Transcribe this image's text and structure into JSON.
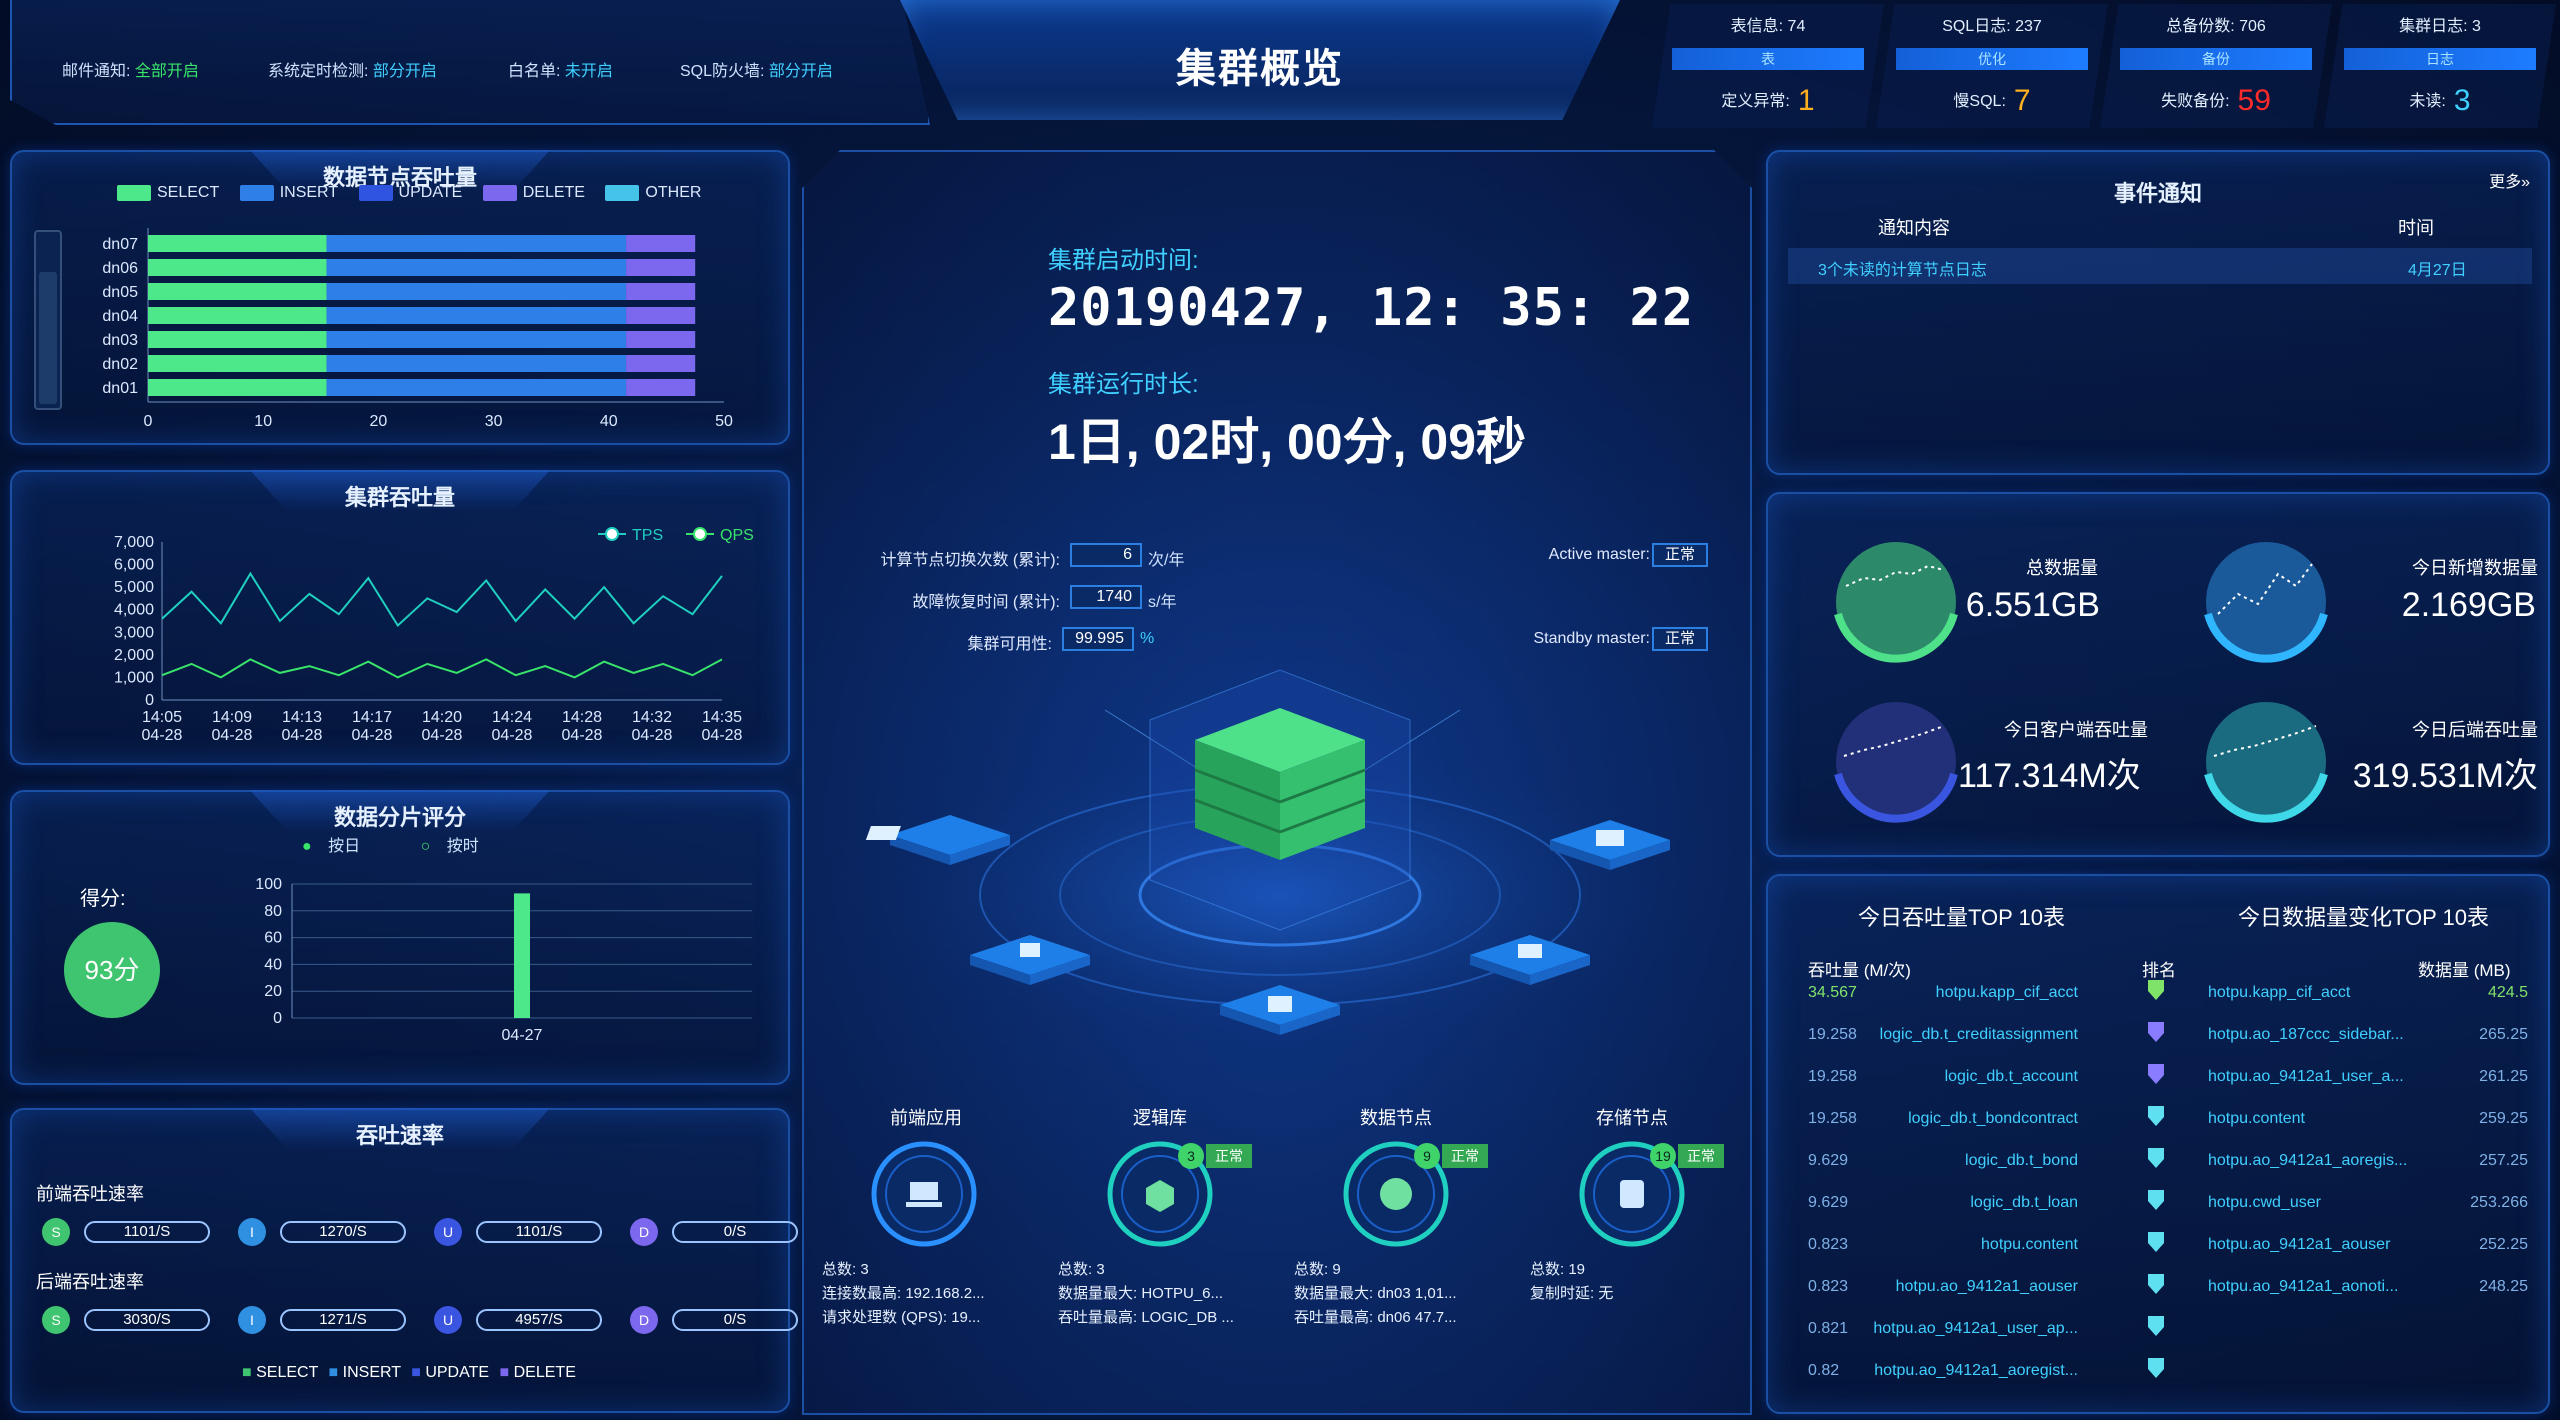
{
  "header": {
    "title": "集群概览",
    "left_items": [
      {
        "label": "邮件通知:",
        "value": "全部开启",
        "color": "#39e46a"
      },
      {
        "label": "系统定时检测:",
        "value": "部分开启",
        "color": "#3fd0ff"
      },
      {
        "label": "白名单:",
        "value": "未开启",
        "color": "#3fd0ff"
      },
      {
        "label": "SQL防火墙:",
        "value": "部分开启",
        "color": "#3fd0ff"
      }
    ],
    "stats": [
      {
        "top_label": "表信息:",
        "top_value": "74",
        "mid": "表",
        "bot_label": "定义异常:",
        "bot_value": "1",
        "bot_color": "#ffb020"
      },
      {
        "top_label": "SQL日志:",
        "top_value": "237",
        "mid": "优化",
        "bot_label": "慢SQL:",
        "bot_value": "7",
        "bot_color": "#ffb020"
      },
      {
        "top_label": "总备份数:",
        "top_value": "706",
        "mid": "备份",
        "bot_label": "失败备份:",
        "bot_value": "59",
        "bot_color": "#ff2a2a"
      },
      {
        "top_label": "集群日志:",
        "top_value": "3",
        "mid": "日志",
        "bot_label": "未读:",
        "bot_value": "3",
        "bot_color": "#3fd0ff"
      }
    ]
  },
  "throughput_nodes": {
    "title": "数据节点吞吐量",
    "legend": [
      {
        "name": "SELECT",
        "color": "#4de88a"
      },
      {
        "name": "INSERT",
        "color": "#2f7fe8"
      },
      {
        "name": "UPDATE",
        "color": "#2f55e0"
      },
      {
        "name": "DELETE",
        "color": "#7b68ee"
      },
      {
        "name": "OTHER",
        "color": "#45c3e8"
      }
    ]
  },
  "cluster_throughput": {
    "title": "集群吞吐量",
    "legend": [
      {
        "name": "TPS",
        "color": "#1fd0c0"
      },
      {
        "name": "QPS",
        "color": "#39e46a"
      }
    ]
  },
  "shard_score": {
    "title": "数据分片评分",
    "legend": [
      {
        "name": "按日",
        "color": "#39e46a"
      },
      {
        "name": "按时",
        "color": "#39e46a"
      }
    ],
    "score_label": "得分:",
    "score_value": "93分"
  },
  "rate": {
    "title": "吞吐速率",
    "front_label": "前端吞吐速率",
    "back_label": "后端吞吐速率",
    "badges": [
      "S",
      "I",
      "U",
      "D"
    ],
    "front_values": [
      "1101/S",
      "1270/S",
      "1101/S",
      "0/S"
    ],
    "back_values": [
      "3030/S",
      "1271/S",
      "4957/S",
      "0/S"
    ],
    "legend": [
      "SELECT",
      "INSERT",
      "UPDATE",
      "DELETE"
    ]
  },
  "center": {
    "start_label": "集群启动时间:",
    "start_value": "20190427, 12: 35: 22",
    "uptime_label": "集群运行时长:",
    "uptime_value": "1日, 02时, 00分, 09秒",
    "switch_label": "计算节点切换次数 (累计):",
    "switch_value": "6",
    "switch_unit": "次/年",
    "recover_label": "故障恢复时间 (累计):",
    "recover_value": "1740",
    "recover_unit": "s/年",
    "avail_label": "集群可用性:",
    "avail_value": "99.995",
    "avail_unit": "%",
    "active_label": "Active master:",
    "active_value": "正常",
    "standby_label": "Standby master:",
    "standby_value": "正常",
    "nodes": [
      {
        "title": "前端应用",
        "count": "",
        "status": "",
        "lines": [
          [
            "总数:",
            "3"
          ],
          [
            "连接数最高:",
            "192.168.2..."
          ],
          [
            "请求处理数 (QPS):",
            "19..."
          ]
        ]
      },
      {
        "title": "逻辑库",
        "count": "3",
        "status": "正常",
        "lines": [
          [
            "总数:",
            "3"
          ],
          [
            "数据量最大:",
            "HOTPU_6..."
          ],
          [
            "吞吐量最高:",
            "LOGIC_DB ..."
          ]
        ]
      },
      {
        "title": "数据节点",
        "count": "9",
        "status": "正常",
        "lines": [
          [
            "总数:",
            "9"
          ],
          [
            "数据量最大:",
            "dn03 1,01..."
          ],
          [
            "吞吐量最高:",
            "dn06 47.7..."
          ]
        ]
      },
      {
        "title": "存储节点",
        "count": "19",
        "status": "正常",
        "lines": [
          [
            "总数:",
            "19"
          ],
          [
            "复制时延:",
            "无"
          ]
        ]
      }
    ]
  },
  "events": {
    "title": "事件通知",
    "more": "更多»",
    "col_content": "通知内容",
    "col_time": "时间",
    "rows": [
      {
        "content": "3个未读的计算节点日志",
        "time": "4月27日"
      }
    ]
  },
  "data_stats": [
    {
      "label": "总数据量",
      "value": "6.551GB",
      "color": "#37b07a"
    },
    {
      "label": "今日新增数据量",
      "value": "2.169GB",
      "color": "#1f9ad8"
    },
    {
      "label": "今日客户端吞吐量",
      "value": "117.314M次",
      "color": "#2f4fd8"
    },
    {
      "label": "今日后端吞吐量",
      "value": "319.531M次",
      "color": "#2fb6c8"
    }
  ],
  "top10": {
    "left_title": "今日吞吐量TOP 10表",
    "right_title": "今日数据量变化TOP 10表",
    "col_throughput": "吞吐量 (M/次)",
    "col_rank": "排名",
    "col_size": "数据量 (MB)",
    "rows": [
      {
        "tp": "34.567",
        "tp_table": "hotpu.kapp_cif_acct",
        "size_table": "hotpu.kapp_cif_acct",
        "size": "424.5"
      },
      {
        "tp": "19.258",
        "tp_table": "logic_db.t_creditassignment",
        "size_table": "hotpu.ao_187ccc_sidebar...",
        "size": "265.25"
      },
      {
        "tp": "19.258",
        "tp_table": "logic_db.t_account",
        "size_table": "hotpu.ao_9412a1_user_a...",
        "size": "261.25"
      },
      {
        "tp": "19.258",
        "tp_table": "logic_db.t_bondcontract",
        "size_table": "hotpu.content",
        "size": "259.25"
      },
      {
        "tp": "9.629",
        "tp_table": "logic_db.t_bond",
        "size_table": "hotpu.ao_9412a1_aoregis...",
        "size": "257.25"
      },
      {
        "tp": "9.629",
        "tp_table": "logic_db.t_loan",
        "size_table": "hotpu.cwd_user",
        "size": "253.266"
      },
      {
        "tp": "0.823",
        "tp_table": "hotpu.content",
        "size_table": "hotpu.ao_9412a1_aouser",
        "size": "252.25"
      },
      {
        "tp": "0.823",
        "tp_table": "hotpu.ao_9412a1_aouser",
        "size_table": "hotpu.ao_9412a1_aonoti...",
        "size": "248.25"
      },
      {
        "tp": "0.821",
        "tp_table": "hotpu.ao_9412a1_user_ap...",
        "size_table": "",
        "size": ""
      },
      {
        "tp": "0.82",
        "tp_table": "hotpu.ao_9412a1_aoregist...",
        "size_table": "",
        "size": ""
      }
    ]
  },
  "chart_data": [
    {
      "type": "bar",
      "orientation": "horizontal",
      "stacked": true,
      "title": "数据节点吞吐量",
      "categories": [
        "dn07",
        "dn06",
        "dn05",
        "dn04",
        "dn03",
        "dn02",
        "dn01"
      ],
      "series": [
        {
          "name": "SELECT",
          "values": [
            15.5,
            15.5,
            15.5,
            15.5,
            15.5,
            15.5,
            15.5
          ]
        },
        {
          "name": "INSERT",
          "values": [
            26,
            26,
            26,
            26,
            26,
            26,
            26
          ]
        },
        {
          "name": "UPDATE",
          "values": [
            0,
            0,
            0,
            0,
            0,
            0,
            0
          ]
        },
        {
          "name": "DELETE",
          "values": [
            6,
            6,
            6,
            6,
            6,
            6,
            6
          ]
        },
        {
          "name": "OTHER",
          "values": [
            0,
            0,
            0,
            0,
            0,
            0,
            0
          ]
        }
      ],
      "xlim": [
        0,
        50
      ],
      "xticks": [
        "0",
        "10",
        "20",
        "30",
        "40",
        "50"
      ]
    },
    {
      "type": "line",
      "title": "集群吞吐量",
      "x": [
        "14:05\n04-28",
        "14:09\n04-28",
        "14:13\n04-28",
        "14:17\n04-28",
        "14:20\n04-28",
        "14:24\n04-28",
        "14:28\n04-28",
        "14:32\n04-28",
        "14:35\n04-28"
      ],
      "xticks": [
        "14:05",
        "14:09",
        "14:13",
        "14:17",
        "14:20",
        "14:24",
        "14:28",
        "14:32",
        "14:35"
      ],
      "xticks2": [
        "04-28",
        "04-28",
        "04-28",
        "04-28",
        "04-28",
        "04-28",
        "04-28",
        "04-28",
        "04-28"
      ],
      "ylim": [
        0,
        7000
      ],
      "yticks": [
        "0",
        "1,000",
        "2,000",
        "3,000",
        "4,000",
        "5,000",
        "6,000",
        "7,000"
      ],
      "series": [
        {
          "name": "TPS",
          "values": [
            3600,
            4800,
            3400,
            5600,
            3500,
            4700,
            3800,
            5400,
            3300,
            4500,
            3900,
            5300,
            3500,
            4900,
            3600,
            5000,
            3400,
            4600,
            3800,
            5500
          ]
        },
        {
          "name": "QPS",
          "values": [
            1100,
            1600,
            1000,
            1800,
            1200,
            1500,
            1100,
            1700,
            1000,
            1600,
            1200,
            1800,
            1100,
            1500,
            1000,
            1700,
            1200,
            1600,
            1100,
            1800
          ]
        }
      ]
    },
    {
      "type": "bar",
      "title": "数据分片评分",
      "categories": [
        "04-27"
      ],
      "series": [
        {
          "name": "按日",
          "values": [
            93
          ]
        }
      ],
      "ylim": [
        0,
        100
      ],
      "yticks": [
        "0",
        "20",
        "40",
        "60",
        "80",
        "100"
      ]
    }
  ]
}
